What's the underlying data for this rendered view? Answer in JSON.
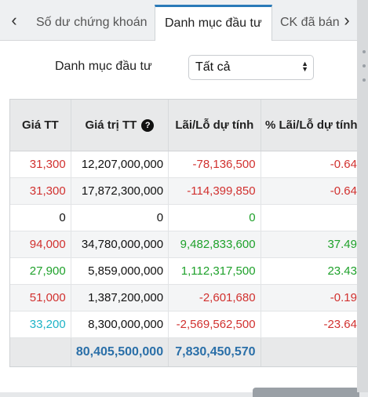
{
  "tabs": {
    "prev_arrow": "‹",
    "next_arrow": "›",
    "items": [
      {
        "label": "Số dư chứng khoán"
      },
      {
        "label": "Danh mục đầu tư"
      },
      {
        "label": "CK đã bán"
      }
    ]
  },
  "filter": {
    "label": "Danh mục đầu tư",
    "selected": "Tất cả"
  },
  "table": {
    "headers": [
      "Giá TT",
      "Giá trị TT",
      "Lãi/Lỗ dự tính",
      "% Lãi/Lỗ dự tính"
    ],
    "rows": [
      {
        "price": "31,300",
        "price_color": "red",
        "value": "12,207,000,000",
        "pl": "-78,136,500",
        "pl_color": "red",
        "pct": "-0.64",
        "pct_color": "red"
      },
      {
        "price": "31,300",
        "price_color": "red",
        "value": "17,872,300,000",
        "pl": "-114,399,850",
        "pl_color": "red",
        "pct": "-0.64",
        "pct_color": "red"
      },
      {
        "price": "0",
        "price_color": "black",
        "value": "0",
        "pl": "0",
        "pl_color": "green",
        "pct": "",
        "pct_color": "black"
      },
      {
        "price": "94,000",
        "price_color": "red",
        "value": "34,780,000,000",
        "pl": "9,482,833,600",
        "pl_color": "green",
        "pct": "37.49",
        "pct_color": "green"
      },
      {
        "price": "27,900",
        "price_color": "green",
        "value": "5,859,000,000",
        "pl": "1,112,317,500",
        "pl_color": "green",
        "pct": "23.43",
        "pct_color": "green"
      },
      {
        "price": "51,000",
        "price_color": "red",
        "value": "1,387,200,000",
        "pl": "-2,601,680",
        "pl_color": "red",
        "pct": "-0.19",
        "pct_color": "red"
      },
      {
        "price": "33,200",
        "price_color": "cyan",
        "value": "8,300,000,000",
        "pl": "-2,569,562,500",
        "pl_color": "red",
        "pct": "-23.64",
        "pct_color": "red"
      }
    ],
    "totals": {
      "value": "80,405,500,000",
      "pl": "7,830,450,570"
    }
  },
  "colors": {
    "red": "#d1312f",
    "green": "#1fa12b",
    "cyan": "#1db3c6",
    "total_blue": "#2a6fa8",
    "active_tab_accent": "#2a7ab8"
  }
}
